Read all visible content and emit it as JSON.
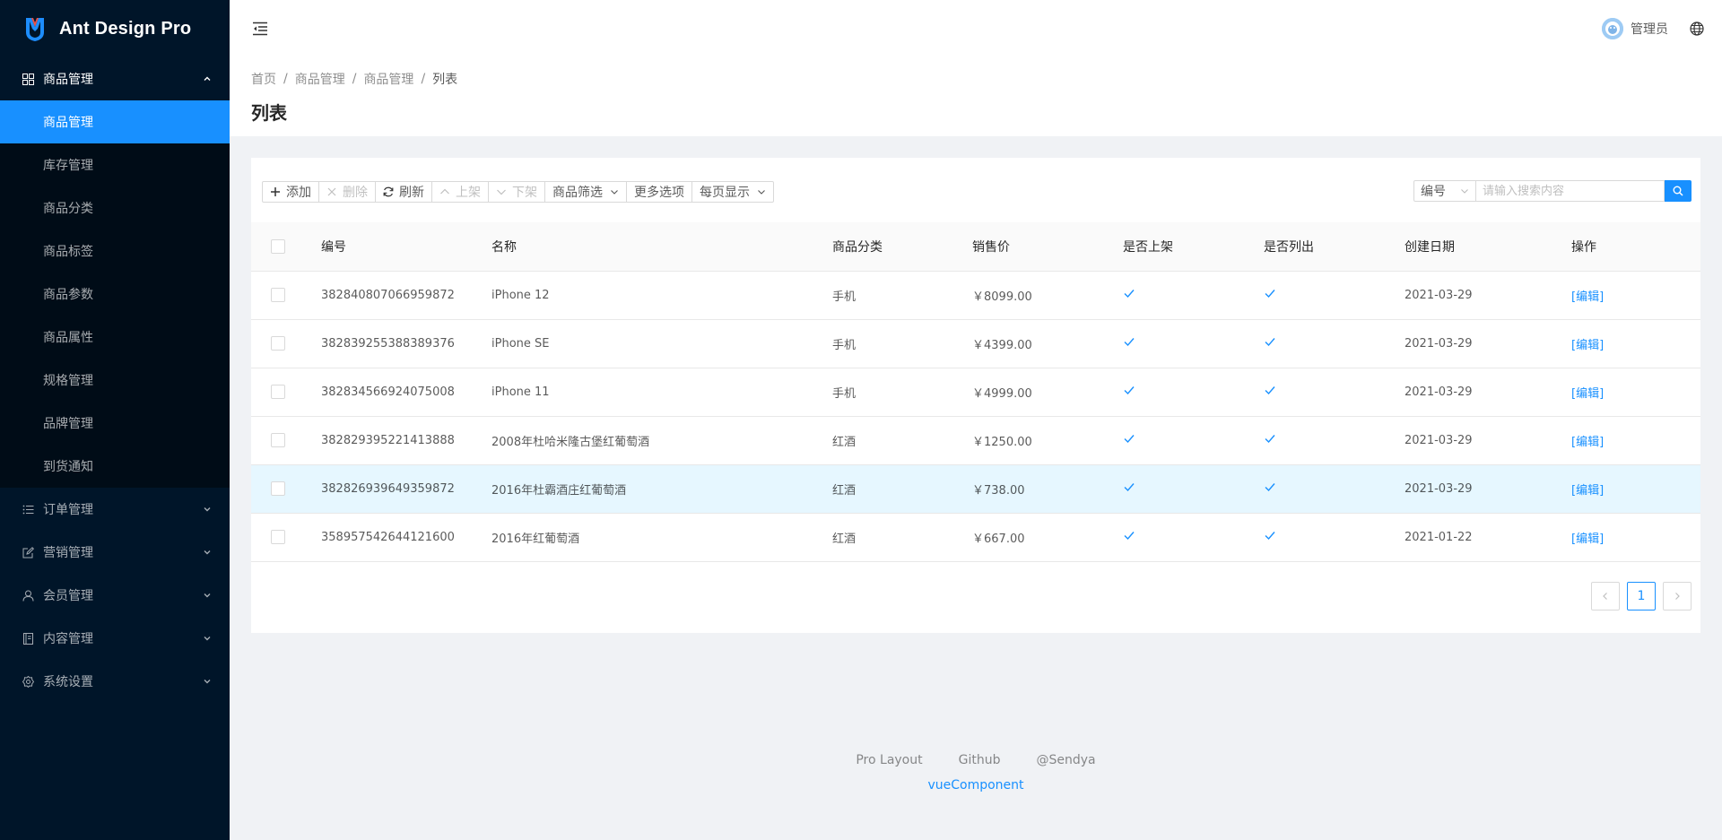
{
  "app": {
    "title": "Ant Design Pro"
  },
  "sidebar": {
    "groups": [
      {
        "label": "商品管理",
        "icon": "appstore-icon",
        "open": true,
        "items": [
          "商品管理",
          "库存管理",
          "商品分类",
          "商品标签",
          "商品参数",
          "商品属性",
          "规格管理",
          "品牌管理",
          "到货通知"
        ],
        "active_item": "商品管理"
      },
      {
        "label": "订单管理",
        "icon": "list-icon"
      },
      {
        "label": "营销管理",
        "icon": "form-icon"
      },
      {
        "label": "会员管理",
        "icon": "user-icon"
      },
      {
        "label": "内容管理",
        "icon": "book-icon"
      },
      {
        "label": "系统设置",
        "icon": "setting-icon"
      }
    ]
  },
  "header": {
    "user_name": "管理员"
  },
  "breadcrumb": [
    "首页",
    "商品管理",
    "商品管理",
    "列表"
  ],
  "page_title": "列表",
  "toolbar": {
    "add": "添加",
    "delete": "删除",
    "refresh": "刷新",
    "on_shelf": "上架",
    "off_shelf": "下架",
    "filter": "商品筛选",
    "more": "更多选项",
    "page_size": "每页显示"
  },
  "search": {
    "field": "编号",
    "placeholder": "请输入搜索内容"
  },
  "table": {
    "columns": [
      "编号",
      "名称",
      "商品分类",
      "销售价",
      "是否上架",
      "是否列出",
      "创建日期",
      "操作"
    ],
    "rows": [
      {
        "id": "382840807066959872",
        "name": "iPhone 12",
        "category": "手机",
        "price": "￥8099.00",
        "on_shelf": true,
        "listed": true,
        "date": "2021-03-29",
        "action": "[编辑]"
      },
      {
        "id": "382839255388389376",
        "name": "iPhone SE",
        "category": "手机",
        "price": "￥4399.00",
        "on_shelf": true,
        "listed": true,
        "date": "2021-03-29",
        "action": "[编辑]"
      },
      {
        "id": "382834566924075008",
        "name": "iPhone 11",
        "category": "手机",
        "price": "￥4999.00",
        "on_shelf": true,
        "listed": true,
        "date": "2021-03-29",
        "action": "[编辑]"
      },
      {
        "id": "382829395221413888",
        "name": "2008年杜哈米隆古堡红葡萄酒",
        "category": "红酒",
        "price": "￥1250.00",
        "on_shelf": true,
        "listed": true,
        "date": "2021-03-29",
        "action": "[编辑]"
      },
      {
        "id": "382826939649359872",
        "name": "2016年杜霸酒庄红葡萄酒",
        "category": "红酒",
        "price": "￥738.00",
        "on_shelf": true,
        "listed": true,
        "date": "2021-03-29",
        "action": "[编辑]",
        "highlighted": true
      },
      {
        "id": "358957542644121600",
        "name": "2016年红葡萄酒",
        "category": "红酒",
        "price": "￥667.00",
        "on_shelf": true,
        "listed": true,
        "date": "2021-01-22",
        "action": "[编辑]"
      }
    ]
  },
  "pagination": {
    "current": "1"
  },
  "footer": {
    "links": [
      "Pro Layout",
      "Github",
      "@Sendya"
    ],
    "copyright": "vueComponent"
  },
  "colors": {
    "primary": "#1890ff",
    "sider": "#001529",
    "submenu": "#000c17",
    "row_highlight": "#e6f7ff"
  }
}
